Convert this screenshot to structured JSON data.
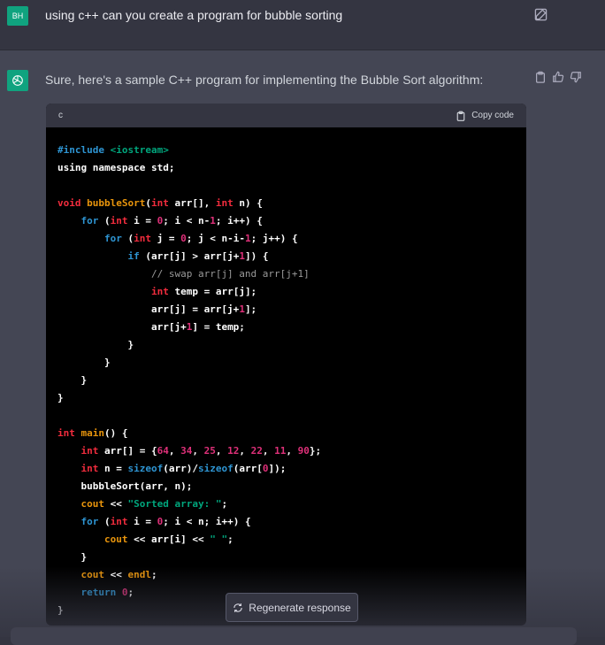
{
  "user": {
    "initials": "BH",
    "message": "using c++ can you create a program for bubble sorting"
  },
  "assistant": {
    "message": "Sure, here's a sample C++ program for implementing the Bubble Sort algorithm:"
  },
  "code_block": {
    "language": "c",
    "copy_label": "Copy code",
    "lines": [
      [
        {
          "t": "#include ",
          "c": "pp"
        },
        {
          "t": "<iostream>",
          "c": "str"
        }
      ],
      [
        {
          "t": "using namespace ",
          "c": ""
        },
        {
          "t": "std",
          "c": ""
        },
        {
          "t": ";",
          "c": ""
        }
      ],
      [],
      [
        {
          "t": "void ",
          "c": "ty"
        },
        {
          "t": "bubbleSort",
          "c": "org"
        },
        {
          "t": "(",
          "c": ""
        },
        {
          "t": "int ",
          "c": "ty"
        },
        {
          "t": "arr[], ",
          "c": ""
        },
        {
          "t": "int ",
          "c": "ty"
        },
        {
          "t": "n) {",
          "c": ""
        }
      ],
      [
        {
          "t": "    ",
          "c": ""
        },
        {
          "t": "for ",
          "c": "kw"
        },
        {
          "t": "(",
          "c": ""
        },
        {
          "t": "int ",
          "c": "ty"
        },
        {
          "t": "i = ",
          "c": ""
        },
        {
          "t": "0",
          "c": "num"
        },
        {
          "t": "; i < n-",
          "c": ""
        },
        {
          "t": "1",
          "c": "num"
        },
        {
          "t": "; i++) {",
          "c": ""
        }
      ],
      [
        {
          "t": "        ",
          "c": ""
        },
        {
          "t": "for ",
          "c": "kw"
        },
        {
          "t": "(",
          "c": ""
        },
        {
          "t": "int ",
          "c": "ty"
        },
        {
          "t": "j = ",
          "c": ""
        },
        {
          "t": "0",
          "c": "num"
        },
        {
          "t": "; j < n-i-",
          "c": ""
        },
        {
          "t": "1",
          "c": "num"
        },
        {
          "t": "; j++) {",
          "c": ""
        }
      ],
      [
        {
          "t": "            ",
          "c": ""
        },
        {
          "t": "if ",
          "c": "kw"
        },
        {
          "t": "(arr[j] > arr[j+",
          "c": ""
        },
        {
          "t": "1",
          "c": "num"
        },
        {
          "t": "]) {",
          "c": ""
        }
      ],
      [
        {
          "t": "                ",
          "c": ""
        },
        {
          "t": "// swap arr[j] and arr[j+1]",
          "c": "cm"
        }
      ],
      [
        {
          "t": "                ",
          "c": ""
        },
        {
          "t": "int ",
          "c": "ty"
        },
        {
          "t": "temp = arr[j];",
          "c": ""
        }
      ],
      [
        {
          "t": "                arr[j] = arr[j+",
          "c": ""
        },
        {
          "t": "1",
          "c": "num"
        },
        {
          "t": "];",
          "c": ""
        }
      ],
      [
        {
          "t": "                arr[j+",
          "c": ""
        },
        {
          "t": "1",
          "c": "num"
        },
        {
          "t": "] = temp;",
          "c": ""
        }
      ],
      [
        {
          "t": "            }",
          "c": ""
        }
      ],
      [
        {
          "t": "        }",
          "c": ""
        }
      ],
      [
        {
          "t": "    }",
          "c": ""
        }
      ],
      [
        {
          "t": "}",
          "c": ""
        }
      ],
      [],
      [
        {
          "t": "int ",
          "c": "ty"
        },
        {
          "t": "main",
          "c": "org"
        },
        {
          "t": "() {",
          "c": ""
        }
      ],
      [
        {
          "t": "    ",
          "c": ""
        },
        {
          "t": "int ",
          "c": "ty"
        },
        {
          "t": "arr[] = {",
          "c": ""
        },
        {
          "t": "64",
          "c": "num"
        },
        {
          "t": ", ",
          "c": ""
        },
        {
          "t": "34",
          "c": "num"
        },
        {
          "t": ", ",
          "c": ""
        },
        {
          "t": "25",
          "c": "num"
        },
        {
          "t": ", ",
          "c": ""
        },
        {
          "t": "12",
          "c": "num"
        },
        {
          "t": ", ",
          "c": ""
        },
        {
          "t": "22",
          "c": "num"
        },
        {
          "t": ", ",
          "c": ""
        },
        {
          "t": "11",
          "c": "num"
        },
        {
          "t": ", ",
          "c": ""
        },
        {
          "t": "90",
          "c": "num"
        },
        {
          "t": "};",
          "c": ""
        }
      ],
      [
        {
          "t": "    ",
          "c": ""
        },
        {
          "t": "int ",
          "c": "ty"
        },
        {
          "t": "n = ",
          "c": ""
        },
        {
          "t": "sizeof",
          "c": "kw"
        },
        {
          "t": "(arr)/",
          "c": ""
        },
        {
          "t": "sizeof",
          "c": "kw"
        },
        {
          "t": "(arr[",
          "c": ""
        },
        {
          "t": "0",
          "c": "num"
        },
        {
          "t": "]);",
          "c": ""
        }
      ],
      [
        {
          "t": "    bubbleSort(arr, n);",
          "c": ""
        }
      ],
      [
        {
          "t": "    ",
          "c": ""
        },
        {
          "t": "cout",
          "c": "org"
        },
        {
          "t": " << ",
          "c": ""
        },
        {
          "t": "\"Sorted array: \"",
          "c": "str"
        },
        {
          "t": ";",
          "c": ""
        }
      ],
      [
        {
          "t": "    ",
          "c": ""
        },
        {
          "t": "for ",
          "c": "kw"
        },
        {
          "t": "(",
          "c": ""
        },
        {
          "t": "int ",
          "c": "ty"
        },
        {
          "t": "i = ",
          "c": ""
        },
        {
          "t": "0",
          "c": "num"
        },
        {
          "t": "; i < n; i++) {",
          "c": ""
        }
      ],
      [
        {
          "t": "        ",
          "c": ""
        },
        {
          "t": "cout",
          "c": "org"
        },
        {
          "t": " << arr[i] << ",
          "c": ""
        },
        {
          "t": "\" \"",
          "c": "str"
        },
        {
          "t": ";",
          "c": ""
        }
      ],
      [
        {
          "t": "    }",
          "c": ""
        }
      ],
      [
        {
          "t": "    ",
          "c": ""
        },
        {
          "t": "cout",
          "c": "org"
        },
        {
          "t": " << ",
          "c": ""
        },
        {
          "t": "endl",
          "c": "org"
        },
        {
          "t": ";",
          "c": ""
        }
      ],
      [
        {
          "t": "    ",
          "c": ""
        },
        {
          "t": "return ",
          "c": "kw"
        },
        {
          "t": "0",
          "c": "num"
        },
        {
          "t": ";",
          "c": ""
        }
      ],
      [
        {
          "t": "}",
          "c": ""
        }
      ]
    ]
  },
  "regenerate_label": "Regenerate response",
  "colors": {
    "accent": "#10a37f",
    "background": "#343541",
    "assistant_background": "#444654",
    "code_background": "#000000"
  }
}
